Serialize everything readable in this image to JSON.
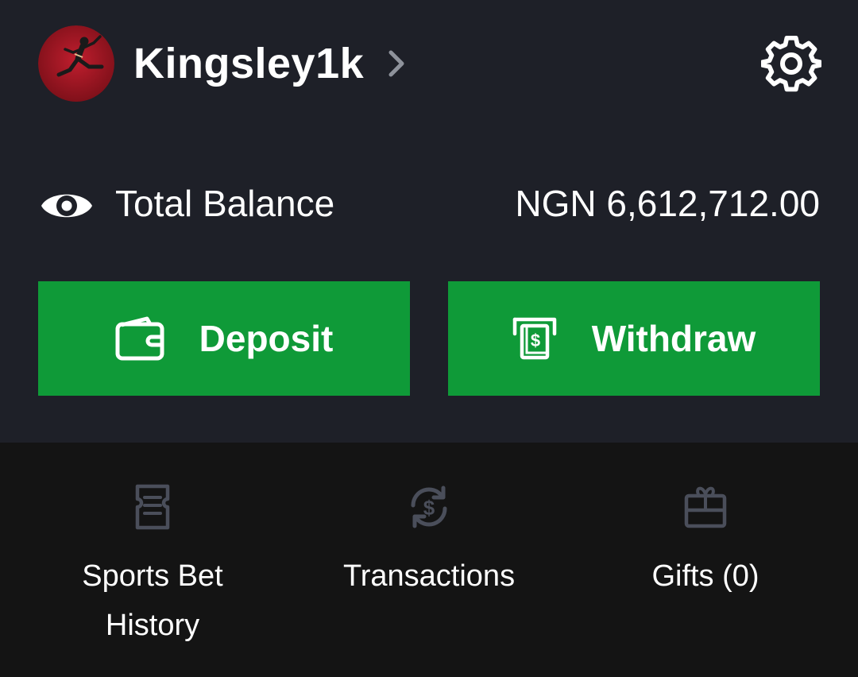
{
  "header": {
    "username": "Kingsley1k",
    "avatar_icon": "runner-avatar",
    "chevron_icon": "chevron-right-icon",
    "settings_icon": "gear-icon"
  },
  "balance": {
    "visibility_icon": "eye-icon",
    "label": "Total Balance",
    "value": "NGN 6,612,712.00"
  },
  "actions": [
    {
      "label": "Deposit",
      "icon": "wallet-icon"
    },
    {
      "label": "Withdraw",
      "icon": "atm-cash-icon"
    }
  ],
  "quick_links": [
    {
      "label_line1": "Sports Bet",
      "label_line2": "History",
      "icon": "ticket-icon"
    },
    {
      "label_line1": "Transactions",
      "label_line2": "",
      "icon": "dollar-exchange-icon"
    },
    {
      "label_line1": "Gifts (0)",
      "label_line2": "",
      "icon": "gift-icon"
    }
  ],
  "colors": {
    "top_panel_bg": "#1e2028",
    "bottom_panel_bg": "#141414",
    "accent_green": "#0f9a38",
    "muted_icon": "#4a4e5a",
    "text": "#ffffff"
  }
}
